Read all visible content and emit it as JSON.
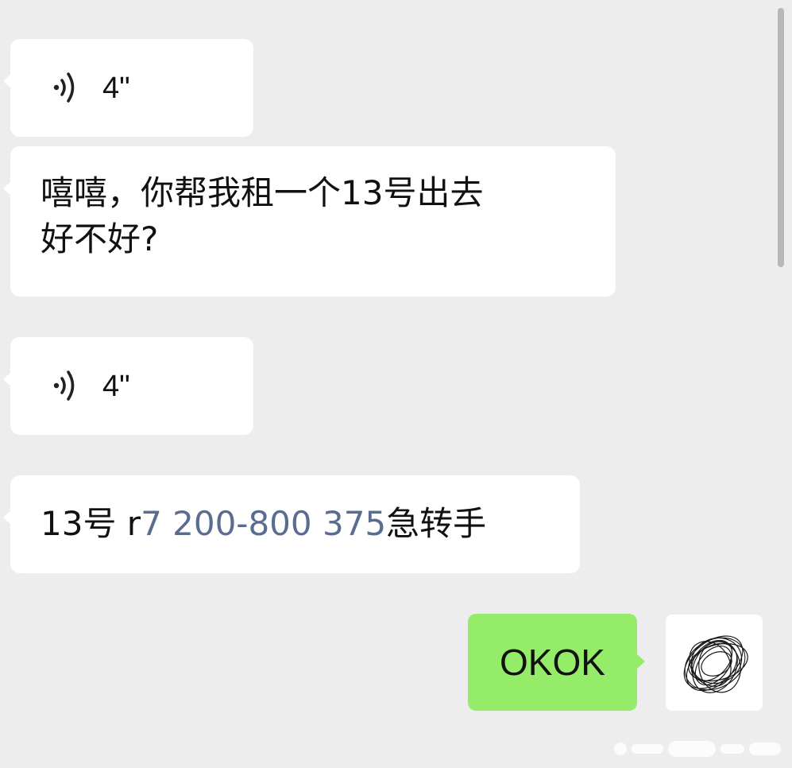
{
  "messages": [
    {
      "type": "voice",
      "direction": "incoming",
      "duration": "4\""
    },
    {
      "type": "text",
      "direction": "incoming",
      "lines": [
        "嘻嘻，你帮我租一个13号出去",
        "好不好?"
      ]
    },
    {
      "type": "voice",
      "direction": "incoming",
      "duration": "4\""
    },
    {
      "type": "text",
      "direction": "incoming",
      "prefix": "13号 r",
      "link": "7 200-800 375",
      "suffix": "急转手"
    },
    {
      "type": "text",
      "direction": "outgoing",
      "text": "OKOK"
    }
  ],
  "colors": {
    "background": "#ededed",
    "incoming_bubble": "#ffffff",
    "outgoing_bubble": "#95ec69",
    "link": "#5a6c8f",
    "text": "#111111"
  },
  "icons": {
    "voice": "sound-wave-icon",
    "avatar": "scribble-avatar"
  }
}
